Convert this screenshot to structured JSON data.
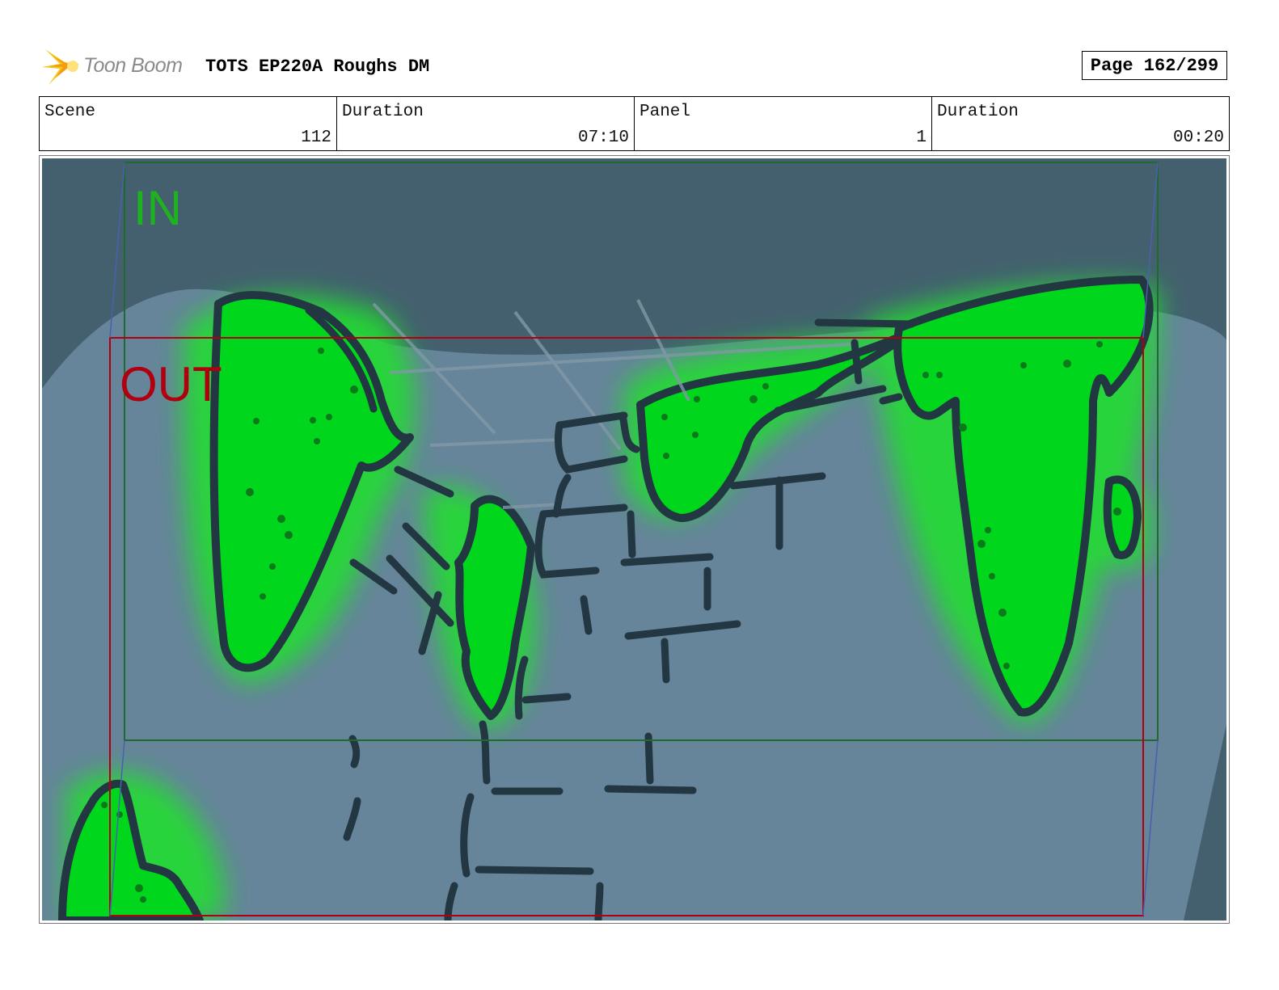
{
  "header": {
    "logo_text": "Toon Boom",
    "title": "TOTS EP220A Roughs DM",
    "page": "Page 162/299"
  },
  "info": {
    "scene_label": "Scene",
    "scene_value": "112",
    "scene_duration_label": "Duration",
    "scene_duration_value": "07:10",
    "panel_label": "Panel",
    "panel_value": "1",
    "panel_duration_label": "Duration",
    "panel_duration_value": "00:20"
  },
  "frame_labels": {
    "in_label": "IN",
    "out_label": "OUT"
  },
  "colors": {
    "sky": "#44606f",
    "rock": "#66849a",
    "slime": "#00e01a",
    "outline": "#223742",
    "in_frame": "#1f6b2e",
    "out_frame": "#b00010",
    "in_text": "#1fb21f",
    "out_text": "#b00010"
  }
}
